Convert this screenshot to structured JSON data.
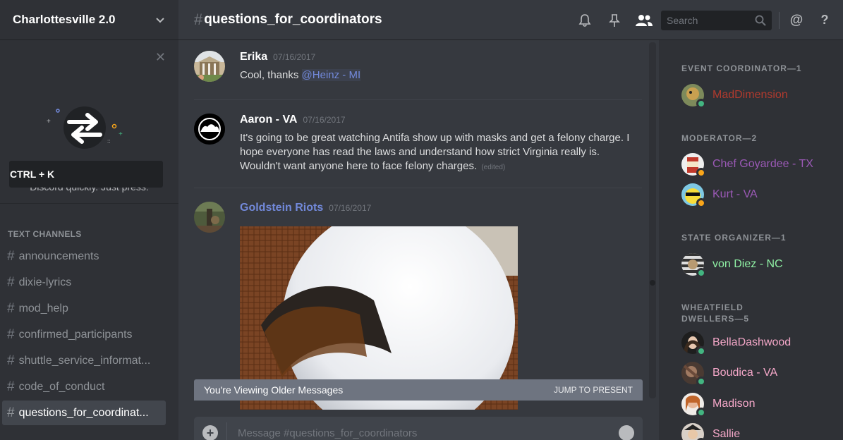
{
  "guild": {
    "name": "Charlottesville 2.0"
  },
  "quick_switcher": {
    "text": "Use Quick Switcher to get around Discord quickly. Just press:",
    "shortcut": "CTRL + K"
  },
  "channels": {
    "category": "TEXT CHANNELS",
    "items": [
      {
        "name": "announcements",
        "active": false
      },
      {
        "name": "dixie-lyrics",
        "active": false
      },
      {
        "name": "mod_help",
        "active": false
      },
      {
        "name": "confirmed_participants",
        "active": false
      },
      {
        "name": "shuttle_service_informat...",
        "active": false
      },
      {
        "name": "code_of_conduct",
        "active": false
      },
      {
        "name": "questions_for_coordinat...",
        "active": true
      }
    ]
  },
  "header": {
    "channel": "questions_for_coordinators",
    "search_placeholder": "Search"
  },
  "messages": [
    {
      "author": "Erika",
      "timestamp": "07/16/2017",
      "text": "Cool, thanks ",
      "mention": "@Heinz - MI",
      "color": "#ffffff"
    },
    {
      "author": "Aaron - VA",
      "timestamp": "07/16/2017",
      "text": "It's going to be great watching Antifa show up with masks and get a felony charge. I hope everyone has read the laws and understand how strict Virginia really is. Wouldn't want anyone here to face felony charges.",
      "edited": "(edited)",
      "color": "#ffffff"
    },
    {
      "author": "Goldstein Riots",
      "timestamp": "07/16/2017",
      "color": "#7289da"
    }
  ],
  "older_messages": {
    "text": "You're Viewing Older Messages",
    "jump": "JUMP TO PRESENT"
  },
  "composer": {
    "placeholder": "Message #questions_for_coordinators"
  },
  "member_list": {
    "roles": [
      {
        "title": "EVENT COORDINATOR—1",
        "members": [
          {
            "name": "MadDimension",
            "color": "#b03a2e",
            "status": "#43b581"
          }
        ]
      },
      {
        "title": "MODERATOR—2",
        "members": [
          {
            "name": "Chef Goyardee - TX",
            "color": "#9b59b6",
            "status": "#faa61a"
          },
          {
            "name": "Kurt - VA",
            "color": "#9b59b6",
            "status": "#faa61a"
          }
        ]
      },
      {
        "title": "STATE ORGANIZER—1",
        "members": [
          {
            "name": "von Diez - NC",
            "color": "#8ff0a4",
            "status": "#43b581"
          }
        ]
      },
      {
        "title": "WHEATFIELD DWELLERS—5",
        "members": [
          {
            "name": "BellaDashwood",
            "color": "#f4a7c8",
            "status": "#43b581"
          },
          {
            "name": "Boudica - VA",
            "color": "#f4a7c8",
            "status": "#43b581"
          },
          {
            "name": "Madison",
            "color": "#f4a7c8",
            "status": "#43b581"
          },
          {
            "name": "Sallie",
            "color": "#f4a7c8",
            "status": "#43b581"
          }
        ]
      }
    ]
  }
}
